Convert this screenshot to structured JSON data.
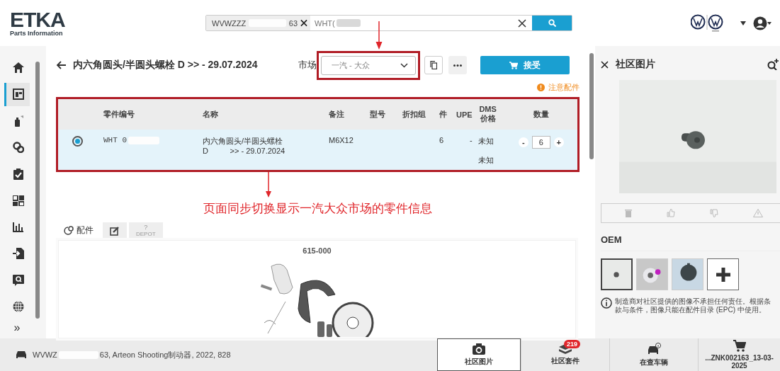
{
  "header": {
    "logo": "ETKA",
    "logo_sub": "Parts Information",
    "search_chip": {
      "prefix": "WVWZZZ",
      "suffix": "63"
    },
    "search_value": "WHT("
  },
  "sidebar": {
    "items": [
      {
        "selected": false
      },
      {
        "selected": true
      },
      {
        "selected": false
      },
      {
        "selected": false
      },
      {
        "selected": false
      },
      {
        "selected": false
      },
      {
        "selected": false
      },
      {
        "selected": false
      },
      {
        "selected": false
      },
      {
        "selected": false
      }
    ],
    "expand": "»"
  },
  "main": {
    "title": "内六角圆头/半圆头螺栓 D >> - 29.07.2024",
    "market_label": "市场",
    "market_value": "一汽 - 大众",
    "accept": "接受",
    "notice": "注意配件",
    "table": {
      "columns": [
        "零件编号",
        "名称",
        "备注",
        "型号",
        "折扣组",
        "件",
        "UPE",
        "DMS 价格",
        "数量"
      ],
      "rows": [
        {
          "selected": true,
          "part_no": "WHT 0",
          "name_lines": [
            "内六角圆头/半圆头螺栓",
            "D          >> - 29.07.2024"
          ],
          "note": "M6X12",
          "unit": "6",
          "upe": "-",
          "dms": [
            "未知",
            "未知"
          ],
          "decrement": "-",
          "quantity": "6",
          "increment": "+"
        }
      ]
    },
    "annotation": "页面同步切换显示一汽大众市场的零件信息",
    "tabs": [
      {
        "kind": "parts",
        "label": "配件",
        "selected": true
      },
      {
        "kind": "edit",
        "selected": false
      },
      {
        "kind": "depot",
        "mark": "?",
        "label": "DEPOT",
        "selected": false
      }
    ],
    "drawing": {
      "label": "615-000"
    }
  },
  "panel": {
    "title": "社区图片",
    "oem_label": "OEM",
    "thumbnails": [
      {
        "selected": true
      },
      {
        "selected": false
      },
      {
        "selected": false
      }
    ],
    "disclaimer": "制造商对社区提供的图像不承担任何责任。根据条款与条件，图像只能在配件目录 (EPC) 中使用。"
  },
  "bottom": {
    "vehicle_prefix": "WVWZ",
    "vehicle_suffix": "63, Arteon Shooting制动器, 2022, 828",
    "tabs": [
      {
        "kind": "camera",
        "label": "社区图片",
        "selected": true
      },
      {
        "kind": "kit",
        "label": "社区套件",
        "badge": "219",
        "selected": false
      },
      {
        "kind": "car",
        "label": "在查车辆",
        "selected": false
      },
      {
        "kind": "cart",
        "label": "...ZNK002163_13-03-2025",
        "selected": false
      }
    ]
  }
}
